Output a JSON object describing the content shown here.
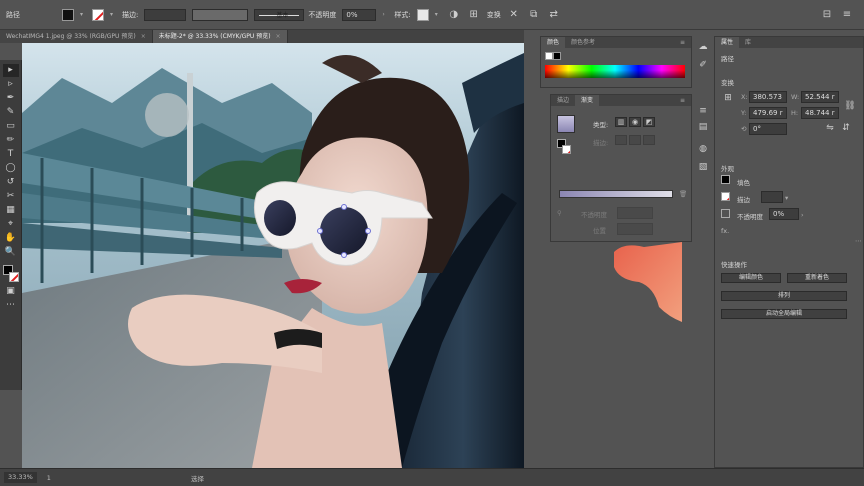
{
  "control_bar": {
    "object_type": "路径",
    "stroke_label": "描边:",
    "stroke_profile": "基本",
    "opacity_label": "不透明度",
    "opacity_value": "0%",
    "style_label": "样式:",
    "transform_label": "变换"
  },
  "tabs": [
    {
      "label": "WechatIMG4 1.jpeg @ 33% (RGB/GPU 预览)",
      "close": "×"
    },
    {
      "label": "未标题-2* @ 33.33% (CMYK/GPU 预览)",
      "close": "×"
    }
  ],
  "tools": [
    "▸",
    "▹",
    "✒",
    "✎",
    "▭",
    "✏",
    "T",
    "◯",
    "↺",
    "✂",
    "▦",
    "⌖",
    "✋",
    "🔍"
  ],
  "color_panel": {
    "tab_color": "颜色",
    "tab_color_guide": "颜色参考"
  },
  "gradient_panel": {
    "tab_stroke": "描边",
    "tab_gradient": "渐变",
    "type_label": "类型:",
    "stroke_label": "描边:",
    "opacity_label": "不透明度",
    "location_label": "位置"
  },
  "properties_panel": {
    "tab_properties": "属性",
    "tab_layers": "库",
    "path_label": "路径",
    "transform_label": "变换",
    "x_value": "380.573",
    "w_value": "52.544 r",
    "y_value": "479.69 r",
    "h_value": "48.744 r",
    "angle_value": "0°",
    "appearance_label": "外观",
    "fill_label": "填色",
    "stroke_label": "描边",
    "opacity_label": "不透明度",
    "opacity_value": "0%",
    "fx": "fx.",
    "quick_actions_label": "快速操作",
    "btn_edit_color": "编辑颜色",
    "btn_recolor": "重新着色",
    "btn_arrange": "排列",
    "btn_global_edit": "启动全局编辑"
  },
  "status_bar": {
    "zoom": "33.33%",
    "page": "1",
    "mode": "选择"
  },
  "colors": {
    "accent_red": "#e02020",
    "gradient_start": "#8b86b3",
    "gradient_end": "#e0dfe8",
    "salmon_shape": "#e8735a"
  }
}
